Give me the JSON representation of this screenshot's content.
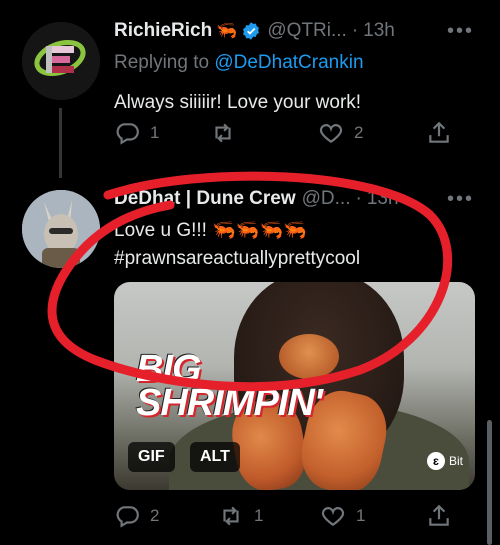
{
  "colors": {
    "background": "#000000",
    "text": "#e7e9ea",
    "muted": "#71767b",
    "link": "#1d9bf0",
    "verified": "#1d9bf0",
    "annotation": "#e5202a"
  },
  "tweets": [
    {
      "display_name": "RichieRich",
      "emoji": "🦐",
      "verified": true,
      "handle": "@QTRi...",
      "separator": "·",
      "time": "13h",
      "reply_prefix": "Replying to",
      "reply_handle": "@DeDhatCrankin",
      "text": "Always siiiiir! Love your work!",
      "actions": {
        "reply": "1",
        "retweet": "",
        "like": "2"
      }
    },
    {
      "display_name": "DeDhat | Dune Crew",
      "handle": "@D...",
      "separator": "·",
      "time": "13h",
      "text": "Love u G!!! 🦐🦐🦐🦐",
      "hashtag": "#prawnsareactuallyprettycool",
      "media": {
        "overlay_line1": "BIG",
        "overlay_line2": "SHRIMPIN'",
        "badge_gif": "GIF",
        "badge_alt": "ALT",
        "source_mark": "ɛ",
        "source_label": "Bit"
      },
      "actions": {
        "reply": "2",
        "retweet": "1",
        "like": "1"
      }
    }
  ],
  "icons": {
    "more": "more-icon",
    "reply": "reply-icon",
    "retweet": "retweet-icon",
    "like": "heart-icon",
    "share": "share-icon",
    "verified": "verified-badge-icon"
  },
  "more_glyph": "•••"
}
